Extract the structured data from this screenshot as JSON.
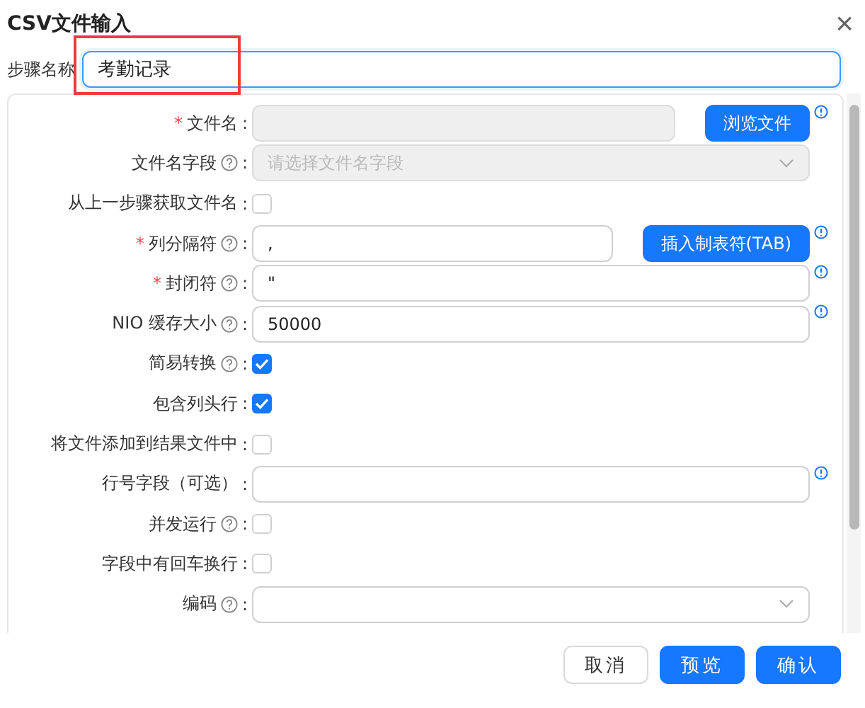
{
  "dialog": {
    "title": "CSV文件输入",
    "close": "×"
  },
  "step_name": {
    "label": "步骤名称",
    "value": "考勤记录",
    "focused": true,
    "highlighted": true
  },
  "fields": [
    {
      "kind": "input",
      "required_mark": "*",
      "label": "文件名",
      "colon": ":",
      "help": false,
      "disabled": true,
      "button": "浏览文件",
      "info": true
    },
    {
      "kind": "select",
      "label": "文件名字段",
      "colon": ":",
      "help": true,
      "placeholder": "请选择文件名字段",
      "disabled": true,
      "info": false
    },
    {
      "kind": "checkbox",
      "label": "从上一步骤获取文件名",
      "colon": ":",
      "help": false,
      "checked": false
    },
    {
      "kind": "input",
      "required_mark": "*",
      "label": "列分隔符",
      "colon": ":",
      "help": true,
      "value": ",",
      "disabled": false,
      "button": "插入制表符(TAB)",
      "info": true
    },
    {
      "kind": "input",
      "required_mark": "*",
      "label": "封闭符",
      "colon": ":",
      "help": true,
      "value": "\"",
      "disabled": false,
      "info": true
    },
    {
      "kind": "input",
      "label": "NIO 缓存大小",
      "colon": ":",
      "help": true,
      "value": "50000",
      "disabled": false,
      "info": true
    },
    {
      "kind": "checkbox",
      "label": "简易转换",
      "colon": ":",
      "help": true,
      "checked": true
    },
    {
      "kind": "checkbox",
      "label": "包含列头行",
      "colon": ":",
      "help": false,
      "checked": true
    },
    {
      "kind": "checkbox",
      "label": "将文件添加到结果文件中",
      "colon": ":",
      "help": false,
      "checked": false
    },
    {
      "kind": "input",
      "label": "行号字段（可选）",
      "colon": ":",
      "help": false,
      "disabled": false,
      "info": true
    },
    {
      "kind": "checkbox",
      "label": "并发运行",
      "colon": ":",
      "help": true,
      "checked": false
    },
    {
      "kind": "checkbox",
      "label": "字段中有回车换行",
      "colon": ":",
      "help": false,
      "checked": false
    },
    {
      "kind": "select",
      "label": "编码",
      "colon": ":",
      "help": true,
      "disabled": false,
      "info": false
    }
  ],
  "buttons": [
    {
      "label": "取消",
      "primary": false
    },
    {
      "label": "预览",
      "primary": true
    },
    {
      "label": "确认",
      "primary": true
    }
  ]
}
